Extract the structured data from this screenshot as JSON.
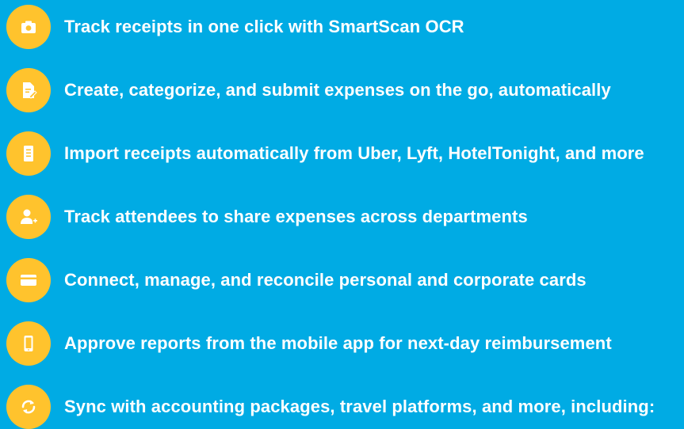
{
  "features": [
    {
      "icon": "camera-icon",
      "text": "Track receipts in one click with SmartScan OCR"
    },
    {
      "icon": "edit-document-icon",
      "text": "Create, categorize, and submit expenses on the go, automatically"
    },
    {
      "icon": "receipt-icon",
      "text": "Import receipts automatically from Uber, Lyft, HotelTonight, and more"
    },
    {
      "icon": "add-user-icon",
      "text": "Track attendees to share expenses across departments"
    },
    {
      "icon": "credit-card-icon",
      "text": "Connect, manage, and reconcile personal and corporate cards"
    },
    {
      "icon": "mobile-phone-icon",
      "text": "Approve reports from the mobile app for next-day reimbursement"
    },
    {
      "icon": "sync-icon",
      "text": "Sync with accounting packages, travel platforms, and more, including:"
    }
  ],
  "colors": {
    "background": "#00abe4",
    "icon_circle": "#ffc32d",
    "text": "#ffffff"
  }
}
